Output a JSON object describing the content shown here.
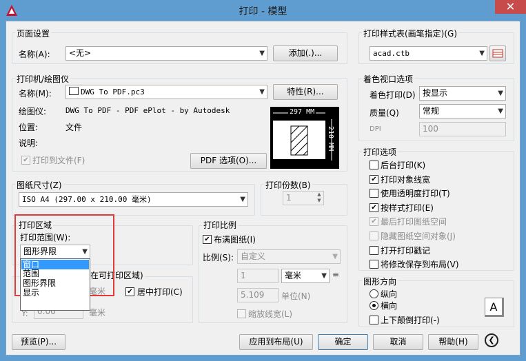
{
  "window": {
    "title": "打印 - 模型",
    "close": "✕"
  },
  "page_setup": {
    "title": "页面设置",
    "name_label": "名称(A):",
    "name_value": "<无>",
    "add_button": "添加(.)..."
  },
  "printer": {
    "title": "打印机/绘图仪",
    "name_label": "名称(M):",
    "name_value": "DWG To PDF.pc3",
    "properties_button": "特性(R)...",
    "plotter_label": "绘图仪:",
    "plotter_value": "DWG To PDF - PDF ePlot - by Autodesk",
    "location_label": "位置:",
    "location_value": "文件",
    "description_label": "说明:",
    "print_to_file": "打印到文件(F)",
    "pdf_options_button": "PDF 选项(O)...",
    "preview_width": "297 MM",
    "preview_height": "210 MM"
  },
  "paper_size": {
    "title": "图纸尺寸(Z)",
    "value": "ISO A4 (297.00 x 210.00 毫米)"
  },
  "copies": {
    "title": "打印份数(B)",
    "value": "1"
  },
  "plot_area": {
    "title": "打印区域",
    "range_label": "打印范围(W):",
    "range_value": "图形界限",
    "dropdown_options": [
      "窗口",
      "范围",
      "图形界限",
      "显示"
    ]
  },
  "offset": {
    "title_fragment": "在可打印区域)",
    "x_unit": "毫米",
    "center_plot": "居中打印(C)",
    "y_label": "Y:",
    "y_value": "0.00",
    "y_unit": "毫米"
  },
  "plot_scale": {
    "title": "打印比例",
    "fit_to_paper": "布满图纸(I)",
    "scale_label": "比例(S):",
    "scale_value": "自定义",
    "value1": "1",
    "unit": "毫米",
    "equals": "=",
    "value2": "5.109",
    "unit2": "单位(N)",
    "scale_lineweights": "缩放线宽(L)"
  },
  "plot_style_table": {
    "title": "打印样式表(画笔指定)(G)",
    "value": "acad.ctb"
  },
  "shaded_viewport": {
    "title": "着色视口选项",
    "shade_label": "着色打印(D)",
    "shade_value": "按显示",
    "quality_label": "质量(Q)",
    "quality_value": "常规",
    "dpi_label": "DPI",
    "dpi_value": "100"
  },
  "plot_options": {
    "title": "打印选项",
    "items": [
      {
        "label": "后台打印(K)",
        "checked": false,
        "disabled": false
      },
      {
        "label": "打印对象线宽",
        "checked": true,
        "disabled": false
      },
      {
        "label": "使用透明度打印(T)",
        "checked": false,
        "disabled": false
      },
      {
        "label": "按样式打印(E)",
        "checked": true,
        "disabled": false
      },
      {
        "label": "最后打印图纸空间",
        "checked": true,
        "disabled": true
      },
      {
        "label": "隐藏图纸空间对象(J)",
        "checked": false,
        "disabled": true
      },
      {
        "label": "打开打印戳记",
        "checked": false,
        "disabled": false
      },
      {
        "label": "将修改保存到布局(V)",
        "checked": false,
        "disabled": false
      }
    ]
  },
  "orientation": {
    "title": "图形方向",
    "portrait": "纵向",
    "landscape": "横向",
    "upside_down": "上下颠倒打印(-)",
    "preview_letter": "A"
  },
  "footer": {
    "preview": "预览(P)...",
    "apply_to_layout": "应用到布局(U)",
    "ok": "确定",
    "cancel": "取消",
    "help": "帮助(H)",
    "more": "❮"
  },
  "colors": {
    "highlight_border": "#e03a3a",
    "selection": "#3399ff"
  }
}
